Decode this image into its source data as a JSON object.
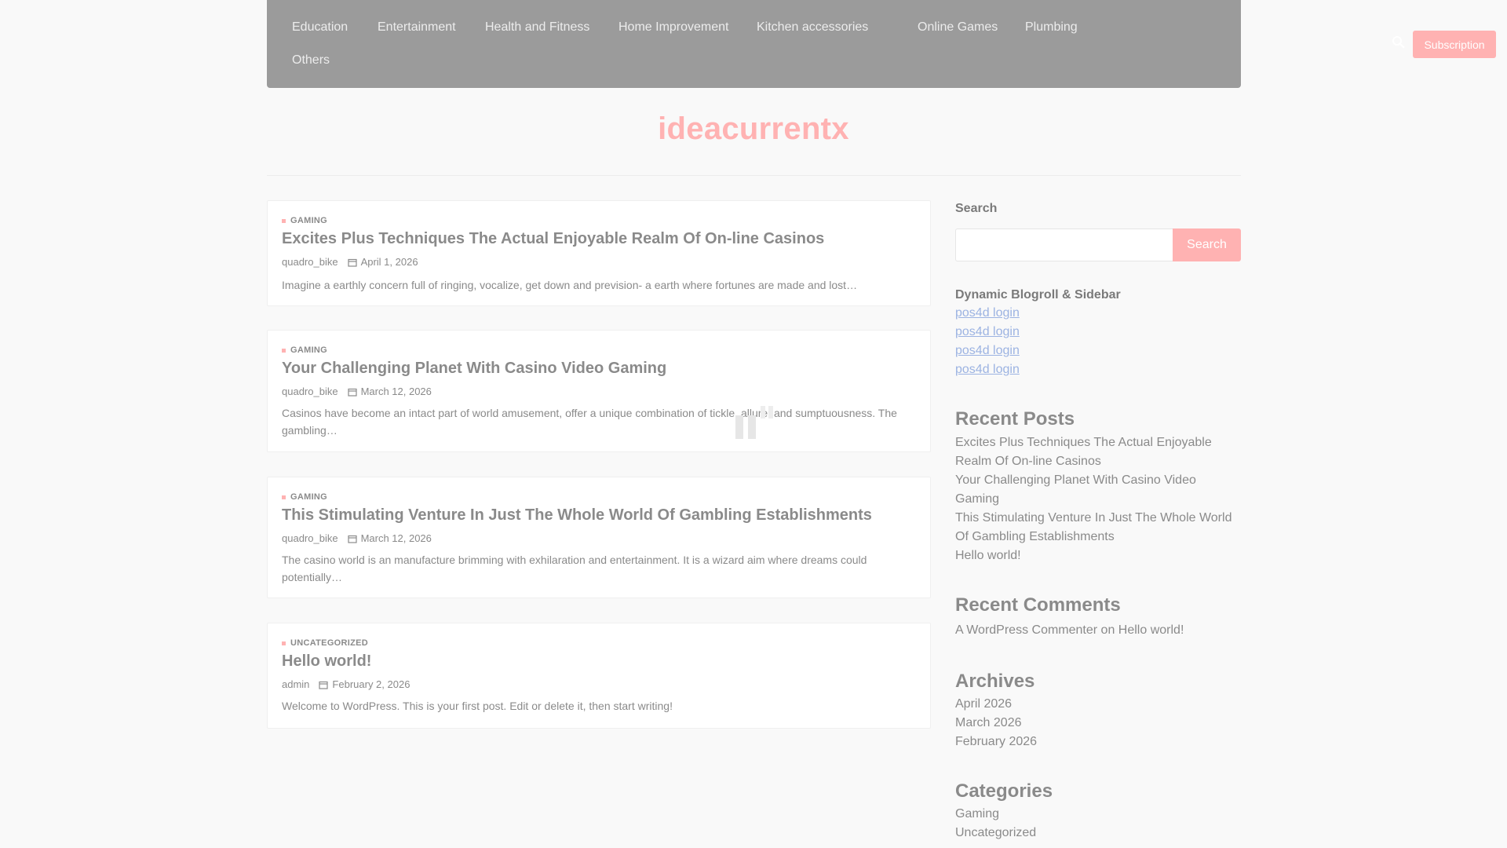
{
  "nav": {
    "items": [
      "Education",
      "Entertainment",
      "Health and Fitness",
      "Home Improvement",
      "Kitchen accessories",
      "Online Games",
      "Plumbing",
      "Others"
    ],
    "subscription_label": "Subscription"
  },
  "site": {
    "title": "ideacurrentx"
  },
  "posts": [
    {
      "category": "GAMING",
      "title": "Excites Plus Techniques The Actual Enjoyable Realm Of On-line Casinos",
      "author": "quadro_bike",
      "date": "April 1, 2026",
      "excerpt": "Imagine a earthly concern full of ringing, vocalize, get down and prevision- a earth where fortunes are made and lost…"
    },
    {
      "category": "GAMING",
      "title": "Your Challenging Planet With Casino Video Gaming",
      "author": "quadro_bike",
      "date": "March 12, 2026",
      "excerpt": "Casinos have become an intact part of world amusement, offer a unique combination of tickle, allure, and sumptuousness. The gambling…"
    },
    {
      "category": "GAMING",
      "title": "This Stimulating Venture In Just The Whole World Of Gambling Establishments",
      "author": "quadro_bike",
      "date": "March 12, 2026",
      "excerpt": "The casino world is an manufacture brimming with exhilaration and entertainment. It is a wizard aim where dreams could potentially…"
    },
    {
      "category": "UNCATEGORIZED",
      "title": "Hello world!",
      "author": "admin",
      "date": "February 2, 2026",
      "excerpt": "Welcome to WordPress. This is your first post. Edit or delete it, then start writing!"
    }
  ],
  "sidebar": {
    "search_label": "Search",
    "search_button": "Search",
    "blogroll_title": "Dynamic Blogroll & Sidebar",
    "blogroll_links": [
      "pos4d login",
      "pos4d login",
      "pos4d login",
      "pos4d login"
    ],
    "recent_posts_title": "Recent Posts",
    "recent_posts": [
      "Excites Plus Techniques The Actual Enjoyable Realm Of On-line Casinos",
      "Your Challenging Planet With Casino Video Gaming",
      "This Stimulating Venture In Just The Whole World Of Gambling Establishments",
      "Hello world!"
    ],
    "recent_comments_title": "Recent Comments",
    "recent_comment": {
      "author": "A WordPress Commenter",
      "on": "on",
      "post": "Hello world!"
    },
    "archives_title": "Archives",
    "archives": [
      "April 2026",
      "March 2026",
      "February 2026"
    ],
    "categories_title": "Categories",
    "categories": [
      "Gaming",
      "Uncategorized"
    ]
  },
  "colors": {
    "accent": "#ffb2b2",
    "nav_bg": "#9b9b9b",
    "link": "#9cb3e2"
  },
  "icons": {
    "search": "search-icon",
    "calendar": "calendar-icon"
  }
}
